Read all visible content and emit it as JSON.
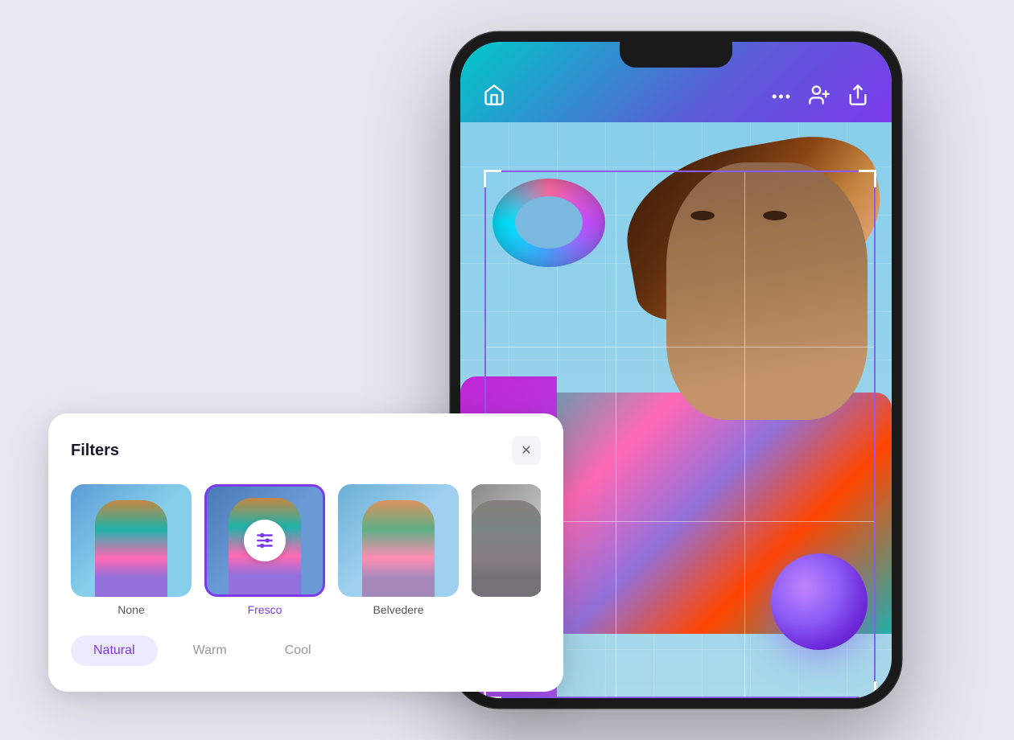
{
  "background_color": "#e8e6f0",
  "phone": {
    "header": {
      "home_icon": "⌂",
      "dots_icon": "•••",
      "add_people_icon": "+👤",
      "share_icon": "⬆"
    }
  },
  "filter_card": {
    "title": "Filters",
    "close_label": "✕",
    "thumbnails": [
      {
        "label": "None",
        "filter_type": "none",
        "selected": false
      },
      {
        "label": "Fresco",
        "filter_type": "fresco",
        "selected": true
      },
      {
        "label": "Belvedere",
        "filter_type": "belvedere",
        "selected": false
      },
      {
        "label": "",
        "filter_type": "fourth",
        "selected": false
      }
    ],
    "tones": [
      {
        "label": "Natural",
        "active": true
      },
      {
        "label": "Warm",
        "active": false
      },
      {
        "label": "Cool",
        "active": false
      }
    ]
  },
  "accent_color": "#7c3aed",
  "icons": {
    "filter_sliders": "⊟"
  }
}
